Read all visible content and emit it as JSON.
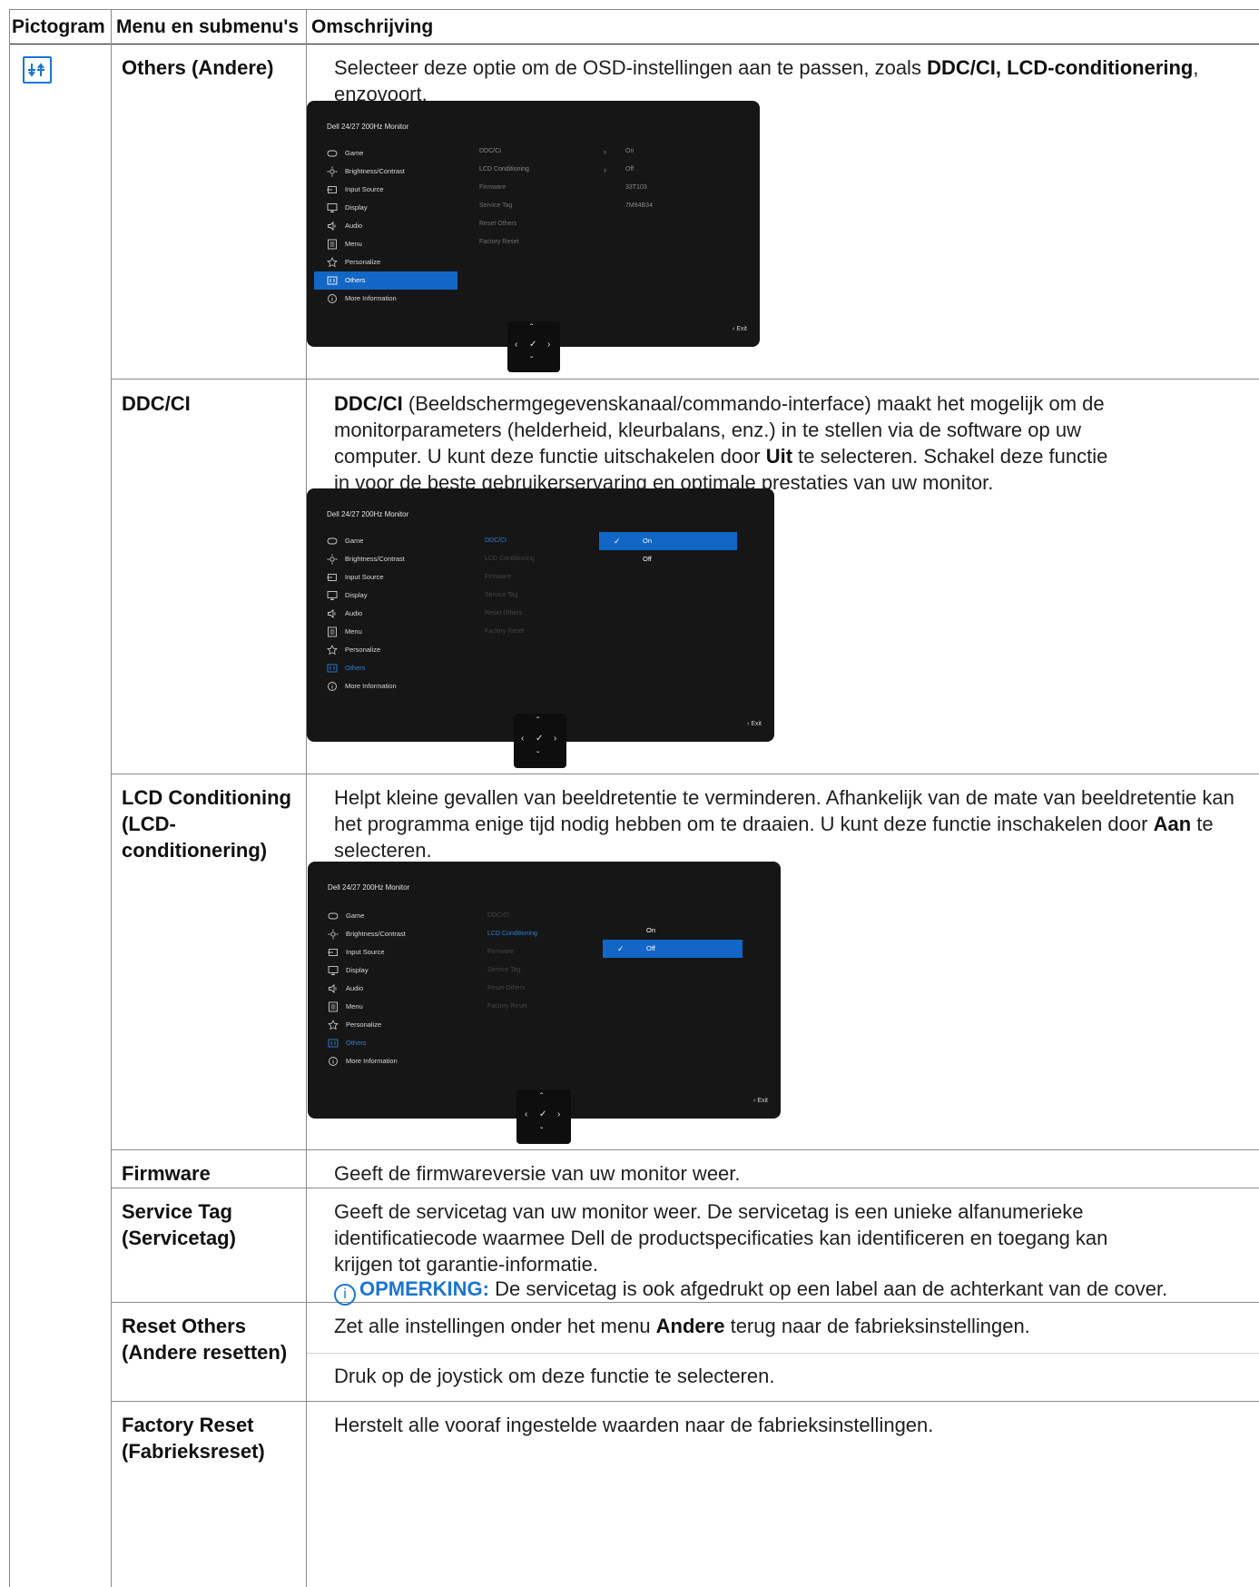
{
  "header": {
    "col1": "Pictogram",
    "col2": "Menu en submenu's",
    "col3": "Omschrijving"
  },
  "icons": {
    "pictogram": "others-sliders-icon",
    "note": "info-circle-icon"
  },
  "colors": {
    "accent": "#1976d2",
    "osd_bg": "#161616",
    "osd_selected": "#1166c6"
  },
  "rows": {
    "others": {
      "name": "Others (Andere)",
      "desc_a": "Selecteer deze optie om de OSD-instellingen aan te passen, zoals ",
      "desc_b": "DDC/CI, LCD-conditionering",
      "desc_c": ", enzovoort."
    },
    "ddcci": {
      "name": "DDC/CI",
      "desc_a": "DDC/CI",
      "desc_b": " (Beeldschermgegevenskanaal/commando-interface) maakt het mogelijk om de monitorparameters (helderheid, kleurbalans, enz.) in te stellen via de software op uw computer. U kunt deze functie uitschakelen door ",
      "desc_c": "Uit",
      "desc_d": " te selecteren. Schakel deze functie in voor de beste gebruikerservaring en optimale prestaties van uw monitor."
    },
    "lcd": {
      "name": "LCD Conditioning (LCD-conditionering)",
      "desc_a": "Helpt kleine gevallen van beeldretentie te verminderen. Afhankelijk van de mate van beeldretentie kan het programma enige tijd nodig hebben om te draaien. U kunt deze functie inschakelen door ",
      "desc_b": "Aan",
      "desc_c": " te selecteren."
    },
    "firmware": {
      "name": "Firmware",
      "desc": "Geeft de firmwareversie van uw monitor weer."
    },
    "servicetag": {
      "name": "Service Tag (Servicetag)",
      "desc": "Geeft de servicetag van uw monitor weer. De servicetag is een unieke alfanumerieke identificatiecode waarmee Dell de productspecificaties kan identificeren en toegang kan krijgen tot garantie-informatie.",
      "note_label": "OPMERKING:",
      "note_text": " De servicetag is ook afgedrukt op een label aan de achterkant van de cover."
    },
    "resetothers": {
      "name": "Reset Others (Andere resetten)",
      "desc_a": "Zet alle instellingen onder het menu ",
      "desc_b": "Andere",
      "desc_c": " terug naar de fabrieksinstellingen.",
      "desc2": "Druk op de joystick om deze functie te selecteren."
    },
    "factoryreset": {
      "name": "Factory Reset (Fabrieksreset)",
      "desc": "Herstelt alle vooraf ingestelde waarden naar de fabrieksinstellingen."
    }
  },
  "osd": {
    "title": "Dell 24/27 200Hz Monitor",
    "menu": [
      "Game",
      "Brightness/Contrast",
      "Input Source",
      "Display",
      "Audio",
      "Menu",
      "Personalize",
      "Others",
      "More Information"
    ],
    "menu_icons": [
      "gamepad-icon",
      "sun-icon",
      "input-icon",
      "display-icon",
      "speaker-icon",
      "menu-icon",
      "star-icon",
      "others-icon",
      "info-icon"
    ],
    "submenu": [
      "DDC/CI",
      "LCD Conditioning",
      "Firmware",
      "Service Tag",
      "Reset Others",
      "Factory Reset"
    ],
    "values": [
      "On",
      "Off",
      "33T103",
      "7M84B34"
    ],
    "options": [
      "On",
      "Off"
    ],
    "exit": "Exit",
    "joystick": {
      "up": "^",
      "left": "<",
      "ok": "✓",
      "right": ">",
      "down": "v"
    }
  }
}
